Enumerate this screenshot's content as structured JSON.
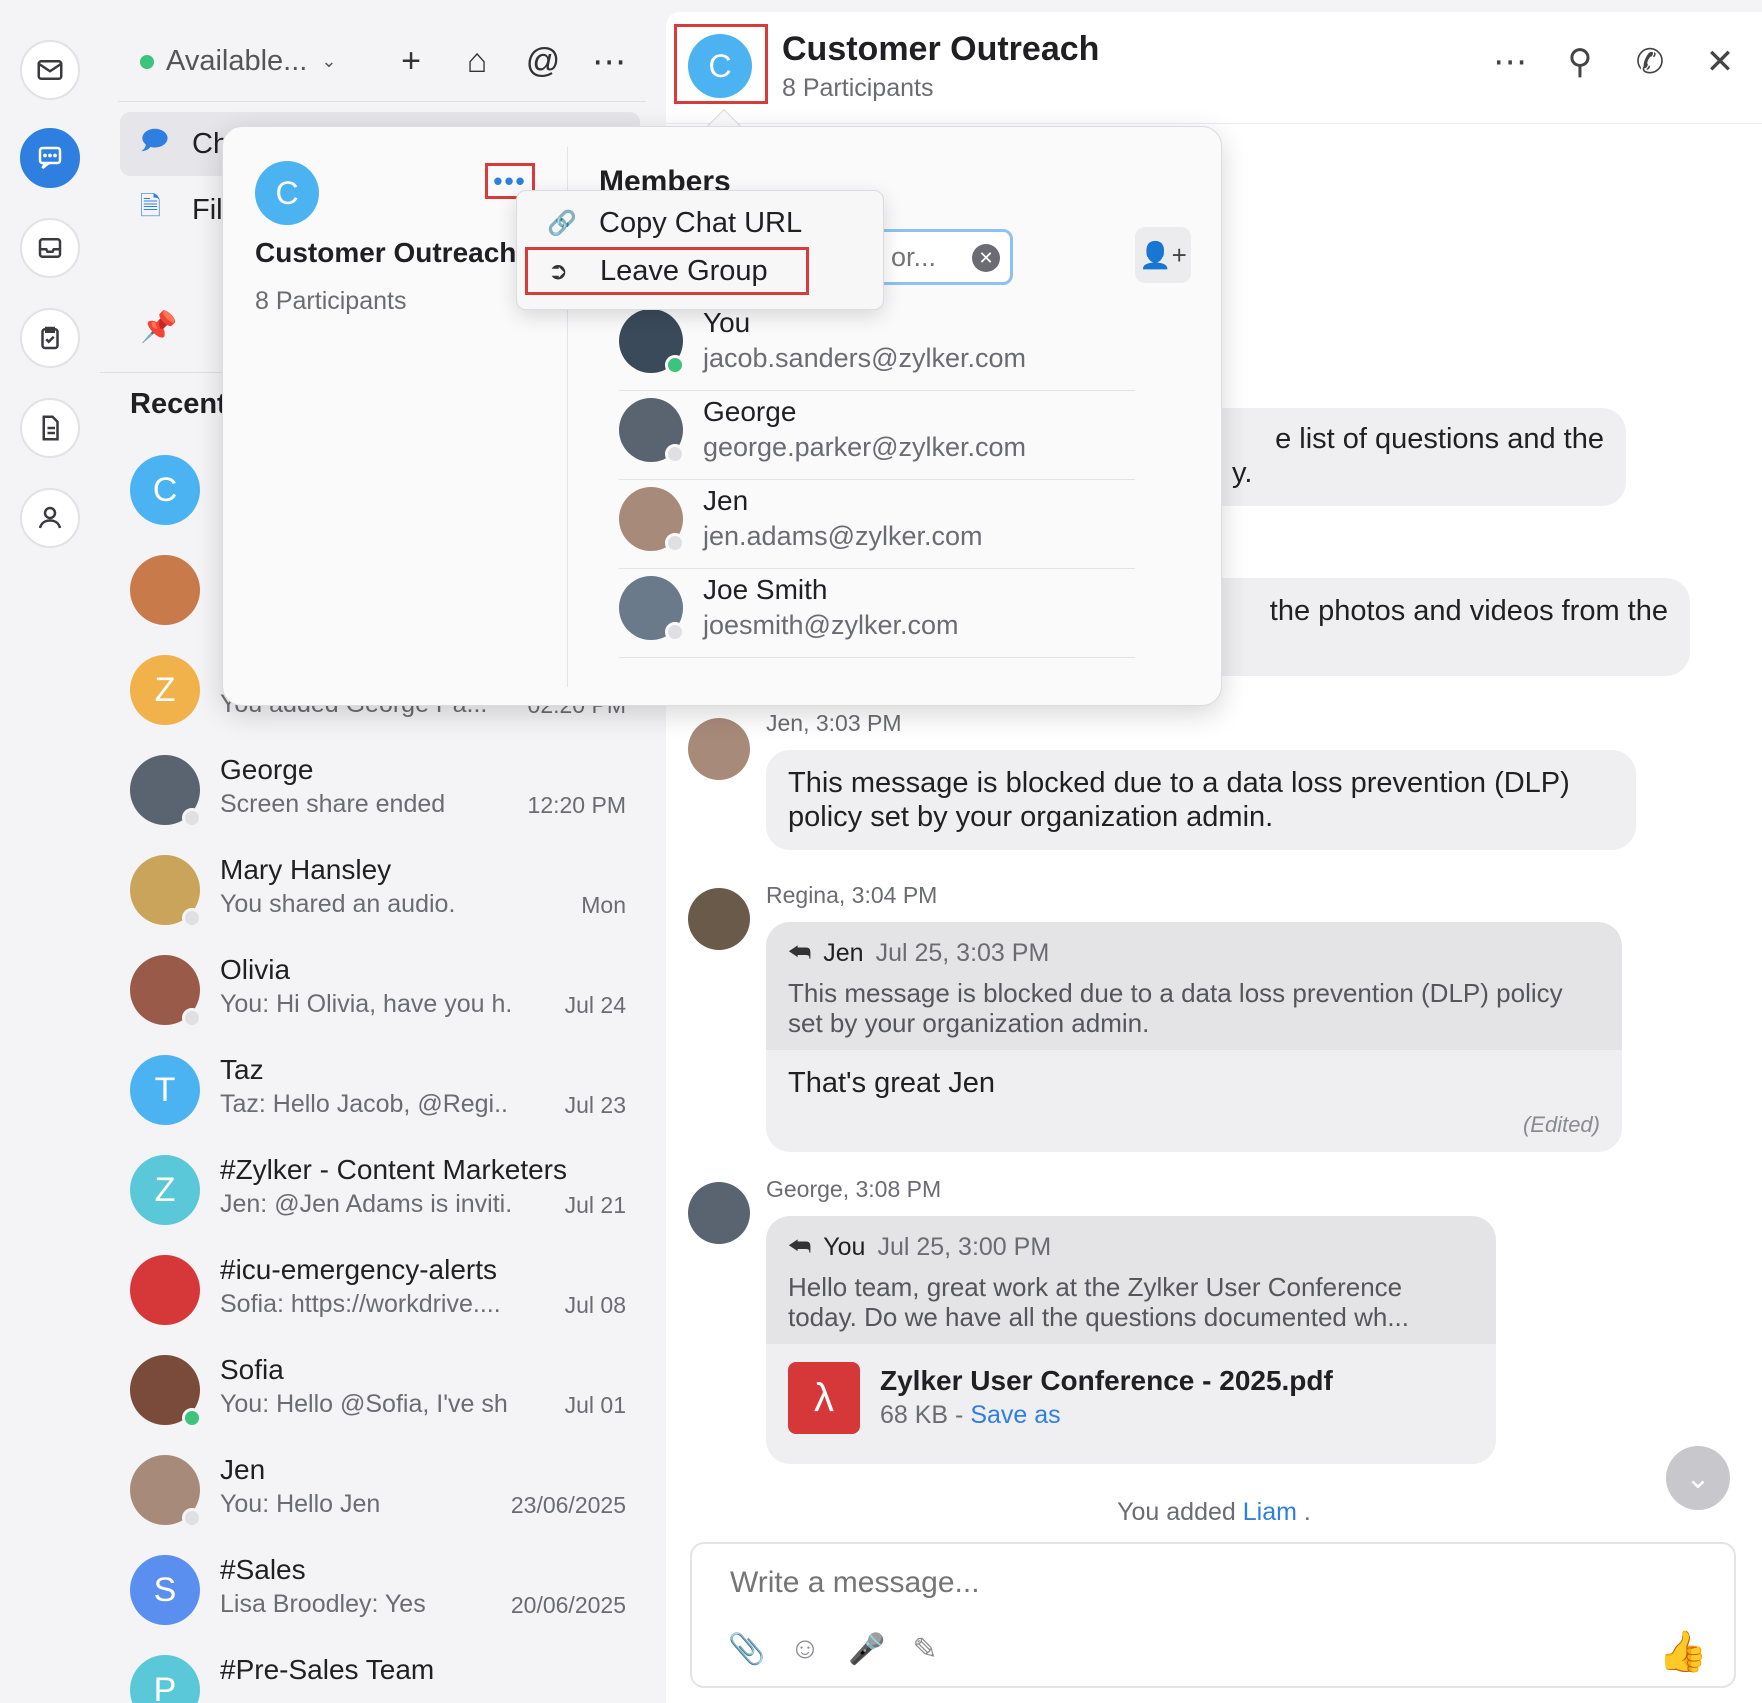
{
  "rail": {
    "items": [
      {
        "name": "mail",
        "icon": "mail-icon"
      },
      {
        "name": "chat",
        "icon": "chat-icon",
        "active": true
      },
      {
        "name": "inbox",
        "icon": "inbox-icon"
      },
      {
        "name": "tasks",
        "icon": "clipboard-icon"
      },
      {
        "name": "notes",
        "icon": "document-icon"
      },
      {
        "name": "contacts",
        "icon": "person-icon"
      }
    ]
  },
  "sidebar": {
    "status": "Available...",
    "nav": [
      {
        "label": "Ch",
        "icon": "chat-bubble-icon"
      },
      {
        "label": "Fil",
        "icon": "file-icon"
      }
    ],
    "recent_label": "Recent",
    "chats": [
      {
        "initial": "C",
        "color": "#4bb3f2",
        "name": "",
        "preview": "",
        "time": ""
      },
      {
        "initial": "",
        "color": "#c97a4a",
        "name": "",
        "preview": "",
        "time": ""
      },
      {
        "initial": "Z",
        "color": "#f2b24b",
        "name": "",
        "preview": "You added George Pa...",
        "time": "02:20 PM"
      },
      {
        "initial": "",
        "color": "#5a6470",
        "name": "George",
        "preview": "Screen share ended",
        "time": "12:20 PM",
        "online": false
      },
      {
        "initial": "",
        "color": "#c9a45a",
        "name": "Mary  Hansley",
        "preview": "You shared an audio.",
        "time": "Mon",
        "online": false
      },
      {
        "initial": "",
        "color": "#9a5a4a",
        "name": "Olivia",
        "preview": "You: Hi Olivia, have you h...",
        "time": "Jul 24",
        "online": false
      },
      {
        "initial": "T",
        "color": "#4bb3f2",
        "name": "Taz",
        "preview": "Taz: Hello Jacob,  @Regi...",
        "time": "Jul 23"
      },
      {
        "initial": "Z",
        "color": "#5ac8d8",
        "name": "#Zylker - Content Marketers",
        "preview": "Jen: @Jen Adams  is inviti...",
        "time": "Jul 21"
      },
      {
        "initial": "",
        "color": "#d6383a",
        "name": "#icu-emergency-alerts",
        "preview": "Sofia: https://workdrive....",
        "time": "Jul 08"
      },
      {
        "initial": "",
        "color": "#7a4a3a",
        "name": "Sofia",
        "preview": "You: Hello @Sofia, I've sh...",
        "time": "Jul 01",
        "online": true
      },
      {
        "initial": "",
        "color": "#a88a7a",
        "name": "Jen",
        "preview": "You: Hello Jen",
        "time": "23/06/2025",
        "online": false
      },
      {
        "initial": "S",
        "color": "#5a8ff0",
        "name": "#Sales",
        "preview": "Lisa Broodley: Yes",
        "time": "20/06/2025"
      },
      {
        "initial": "P",
        "color": "#5ac8d8",
        "name": "#Pre-Sales Team",
        "preview": "",
        "time": ""
      }
    ]
  },
  "header": {
    "initial": "C",
    "title": "Customer Outreach",
    "subtitle": "8 Participants"
  },
  "messages": {
    "partial1": "e list of questions and the",
    "partial1b": "y.",
    "partial2": "the photos and videos from the",
    "jen": {
      "meta": "Jen, 3:03 PM",
      "text": "This message is blocked due to a data loss prevention (DLP) policy set by your organization admin."
    },
    "regina": {
      "meta": "Regina, 3:04 PM",
      "reply_name": "Jen",
      "reply_date": "Jul 25, 3:03 PM",
      "reply_text": "This message is blocked due to a data loss prevention (DLP) policy set by your organization admin.",
      "text": "That's great Jen",
      "edited": "(Edited)"
    },
    "george": {
      "meta": "George, 3:08 PM",
      "reply_name": "You",
      "reply_date": "Jul 25, 3:00 PM",
      "reply_text": "Hello team, great work at the Zylker User Conference today. Do we have all the questions documented wh...",
      "file_name": "Zylker User Conference - 2025.pdf",
      "file_size": "68 KB - ",
      "save_as": "Save as"
    },
    "system_prefix": "You added ",
    "system_name": "Liam",
    "system_suffix": " ."
  },
  "composer": {
    "placeholder": "Write a message..."
  },
  "popover": {
    "initial": "C",
    "title": "Customer Outreach",
    "subtitle": "8 Participants",
    "more": "•••",
    "members_title": "Members",
    "search_placeholder": "rs by name or...",
    "members": [
      {
        "name": "You",
        "email": "jacob.sanders@zylker.com",
        "online": true,
        "color": "#3a4a5a"
      },
      {
        "name": "George",
        "email": "george.parker@zylker.com",
        "online": false,
        "color": "#5a6470"
      },
      {
        "name": "Jen",
        "email": "jen.adams@zylker.com",
        "online": false,
        "color": "#a88a7a"
      },
      {
        "name": "Joe Smith",
        "email": "joesmith@zylker.com",
        "online": false,
        "color": "#6a7a8a"
      }
    ]
  },
  "context_menu": {
    "copy_url": "Copy Chat URL",
    "leave_group": "Leave Group"
  },
  "colors": {
    "accent": "#2f7fe0",
    "highlight": "#d93a3a",
    "online": "#3cc47c"
  }
}
